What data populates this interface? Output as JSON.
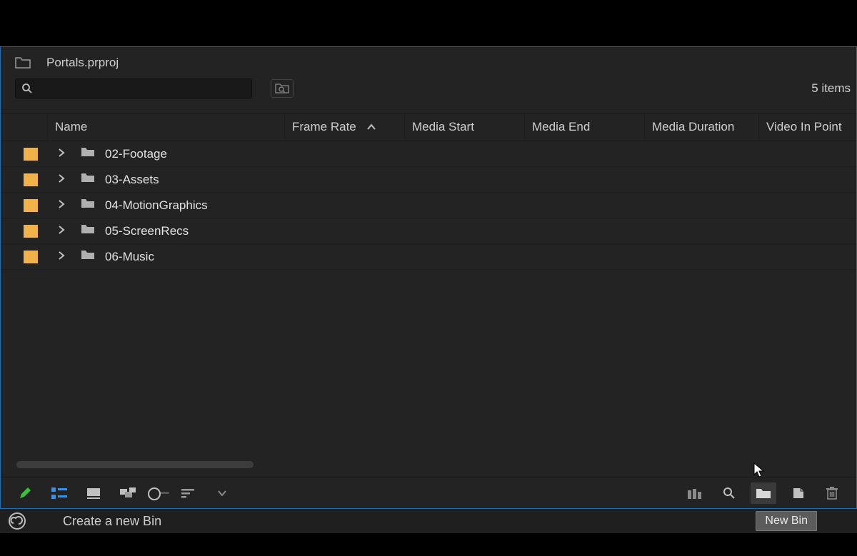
{
  "project": {
    "filename": "Portals.prproj"
  },
  "search": {
    "value": ""
  },
  "items_count_label": "5 items",
  "columns": {
    "name": "Name",
    "frame_rate": "Frame Rate",
    "media_start": "Media Start",
    "media_end": "Media End",
    "media_duration": "Media Duration",
    "video_in_point": "Video In Point"
  },
  "bins": [
    {
      "name": "02-Footage"
    },
    {
      "name": "03-Assets"
    },
    {
      "name": "04-MotionGraphics"
    },
    {
      "name": "05-ScreenRecs"
    },
    {
      "name": "06-Music"
    }
  ],
  "colors": {
    "label_chip": "#f2b24a",
    "accent": "#1a6fb5",
    "listview_blue": "#3a90e5",
    "pencil_green": "#3fbf3f"
  },
  "status": {
    "hint": "Create a new Bin"
  },
  "tooltip": {
    "text": "New Bin"
  }
}
